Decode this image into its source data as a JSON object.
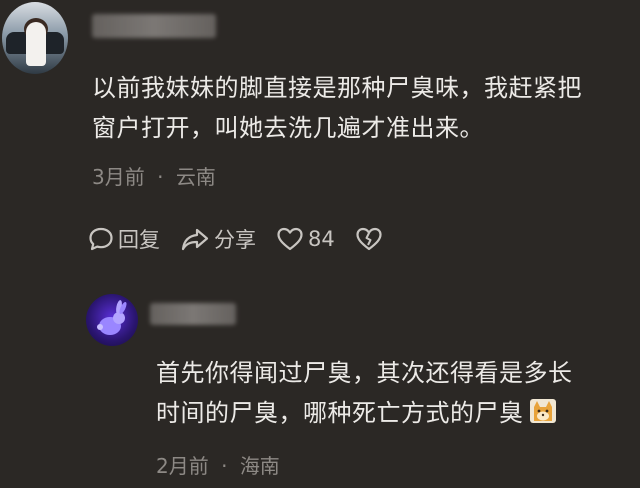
{
  "comment1": {
    "text_line1": "以前我妹妹的脚直接是那种尸臭味，我赶紧把",
    "text_line2": "窗户打开，叫她去洗几遍才准出来。",
    "time": "3月前",
    "separator": "·",
    "location": "云南",
    "actions": {
      "reply_label": "回复",
      "share_label": "分享",
      "like_count": "84"
    }
  },
  "comment2": {
    "text_line1": "首先你得闻过尸臭，其次还得看是多长",
    "text_line2": "时间的尸臭，哪种死亡方式的尸臭",
    "time": "2月前",
    "separator": "·",
    "location": "海南"
  },
  "icons": {
    "reply": "comment-bubble-icon",
    "share": "share-arrow-icon",
    "like": "heart-icon",
    "dislike": "broken-heart-icon",
    "emoji": "shiba-dog-emoji-icon"
  },
  "colors": {
    "background": "#2b2825",
    "text": "#eceae7",
    "meta": "#8d8985"
  }
}
